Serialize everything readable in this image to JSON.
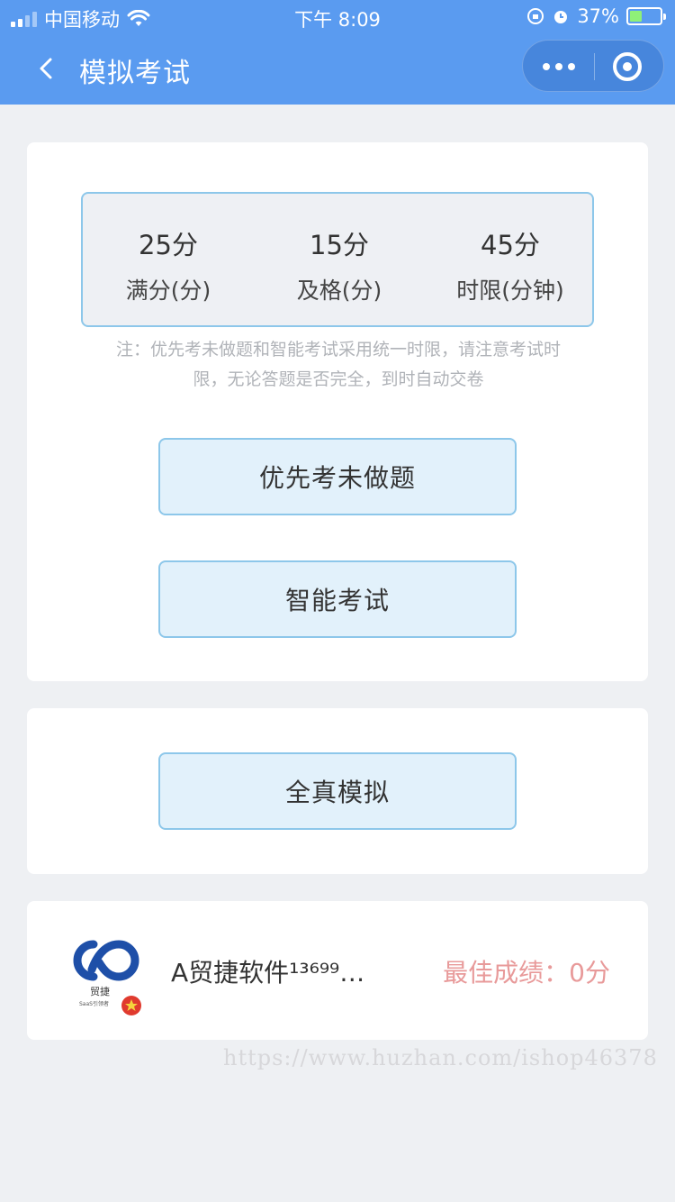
{
  "status_bar": {
    "carrier": "中国移动",
    "time": "下午 8:09",
    "battery_percent": "37%",
    "battery_level": 0.37
  },
  "navbar": {
    "title": "模拟考试",
    "background_color": "#5a9bf0"
  },
  "exam_info": {
    "stats": [
      {
        "value": "25分",
        "label": "满分(分)"
      },
      {
        "value": "15分",
        "label": "及格(分)"
      },
      {
        "value": "45分",
        "label": "时限(分钟)"
      }
    ],
    "note_line1": "注：优先考未做题和智能考试采用统一时限，请注意考试时",
    "note_line2": "限，无论答题是否完全，到时自动交卷"
  },
  "buttons": {
    "priority_unanswered": "优先考未做题",
    "smart_exam": "智能考试",
    "full_simulation": "全真模拟"
  },
  "user": {
    "name": "A贸捷软件¹³⁶⁹⁹…",
    "best_score": "最佳成绩：0分",
    "logo_text": "贸捷",
    "logo_subtext": "SaaS引领者"
  },
  "watermark": "https://www.huzhan.com/ishop46378"
}
